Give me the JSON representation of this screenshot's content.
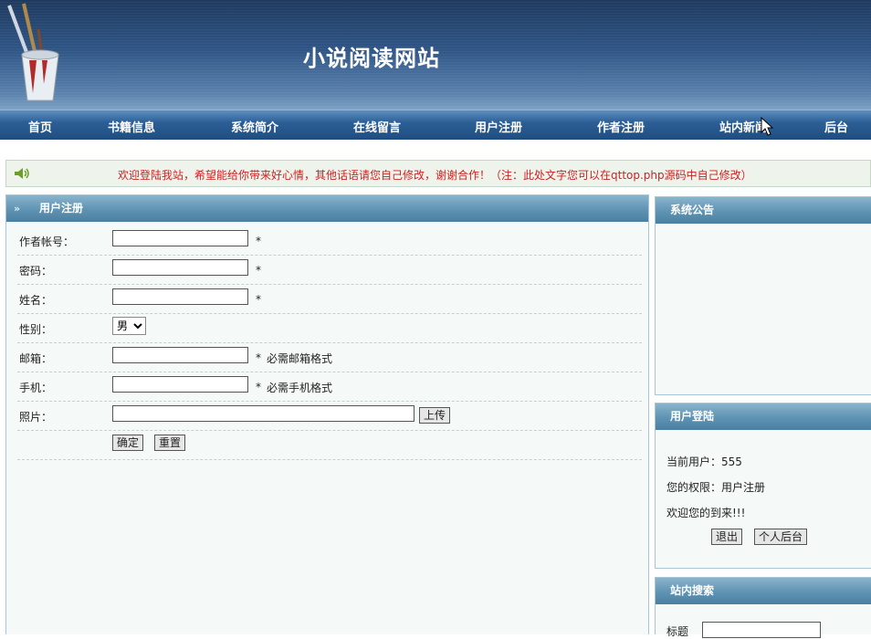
{
  "header": {
    "site_title": "小说阅读网站",
    "logo": "paint-cup-logo"
  },
  "nav": {
    "items": [
      "首页",
      "书籍信息",
      "系统简介",
      "在线留言",
      "用户注册",
      "作者注册",
      "站内新闻",
      "后台"
    ]
  },
  "notice": {
    "icon": "speaker-icon",
    "text": "欢迎登陆我站，希望能给你带来好心情，其他话语请您自己修改，谢谢合作！（注：此处文字您可以在qttop.php源码中自己修改）"
  },
  "register": {
    "title": "用户注册",
    "fields": {
      "account_label": "作者帐号：",
      "password_label": "密码：",
      "name_label": "姓名：",
      "gender_label": "性别：",
      "gender_value": "男",
      "email_label": "邮箱：",
      "email_hint": "必需邮箱格式",
      "phone_label": "手机：",
      "phone_hint": "必需手机格式",
      "photo_label": "照片："
    },
    "required_mark": "*",
    "upload_button": "上传",
    "submit_button": "确定",
    "reset_button": "重置"
  },
  "sidebar": {
    "announcement_title": "系统公告",
    "login": {
      "title": "用户登陆",
      "current_user": "当前用户：555",
      "permission": "您的权限：用户注册",
      "welcome": "欢迎您的到来!!!",
      "logout_button": "退出",
      "backend_button": "个人后台"
    },
    "search": {
      "title": "站内搜索",
      "title_label": "标题"
    }
  },
  "colors": {
    "header": "#2f5585",
    "nav": "#2c5f96",
    "notice_text": "#cc2222",
    "panel_head": "#5e93b3"
  }
}
